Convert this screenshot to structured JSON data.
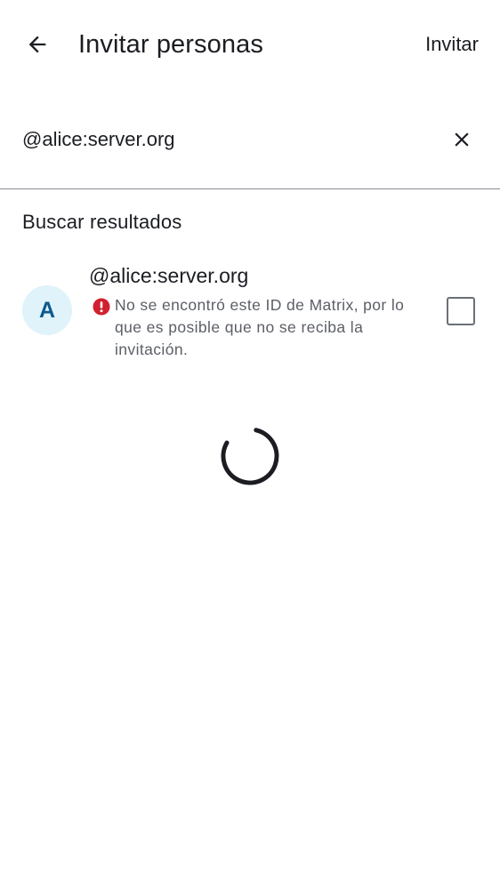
{
  "header": {
    "title": "Invitar personas",
    "action_label": "Invitar",
    "back_icon": "arrow-left-icon"
  },
  "search": {
    "value": "@alice:server.org",
    "clear_icon": "close-icon"
  },
  "results": {
    "section_title": "Buscar resultados",
    "items": [
      {
        "avatar_letter": "A",
        "name": "@alice:server.org",
        "message": "No se encontró este ID de Matrix, por lo que es posible que no se reciba la invitación.",
        "status_icon": "error-icon",
        "selected": false
      }
    ]
  },
  "loading": true,
  "colors": {
    "text_primary": "#1b1d22",
    "text_secondary": "#5b5f66",
    "error": "#d1202f",
    "avatar_bg": "#e0f3fa",
    "avatar_fg": "#0c5a8f",
    "divider": "#8a8d93"
  }
}
